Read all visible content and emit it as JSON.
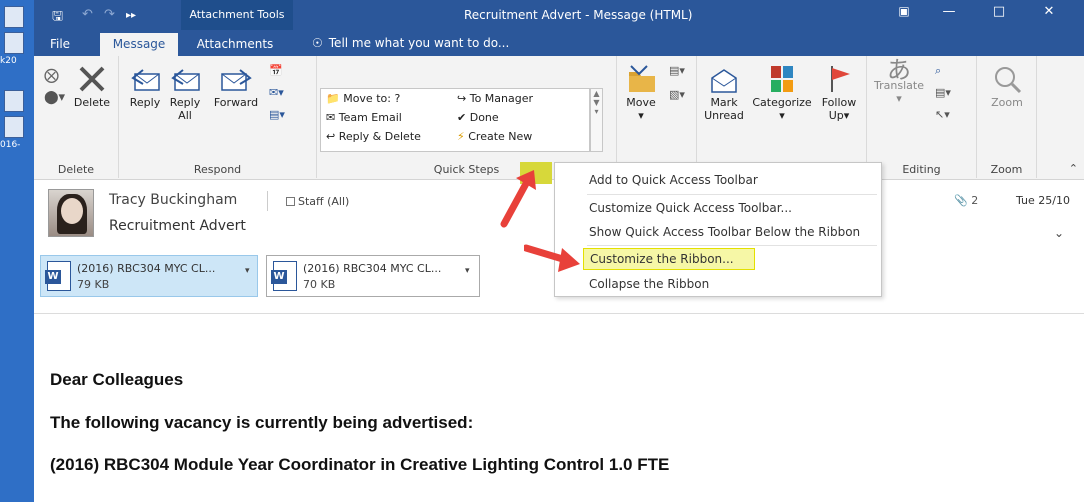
{
  "desktop": {
    "labels": [
      "k20",
      "016-"
    ]
  },
  "titlebar": {
    "context_tab": "Attachment Tools",
    "title": "Recruitment Advert - Message (HTML)",
    "tabs": [
      "File",
      "Message",
      "Attachments"
    ],
    "tell_me": "Tell me what you want to do..."
  },
  "ribbon": {
    "delete_group": {
      "label": "Delete",
      "delete_btn": "Delete"
    },
    "respond_group": {
      "label": "Respond",
      "reply": "Reply",
      "reply_all_1": "Reply",
      "reply_all_2": "All",
      "forward": "Forward"
    },
    "quick_steps_group": {
      "label": "Quick Steps",
      "items": [
        "Move to: ?",
        "To Manager",
        "Team Email",
        "Done",
        "Reply & Delete",
        "Create New"
      ]
    },
    "move_group": {
      "move": "Move"
    },
    "tags_group": {
      "mark_unread_1": "Mark",
      "mark_unread_2": "Unread",
      "categorize": "Categorize",
      "follow_up_1": "Follow",
      "follow_up_2": "Up"
    },
    "editing_group": {
      "label": "Editing",
      "translate": "Translate"
    },
    "zoom_group": {
      "label": "Zoom",
      "zoom": "Zoom"
    }
  },
  "message": {
    "sender": "Tracy Buckingham",
    "recipient": "Staff (All)",
    "subject": "Recruitment Advert",
    "attachment_count": "2",
    "date": "Tue 25/10"
  },
  "attachments": [
    {
      "name": "(2016) RBC304 MYC CL...",
      "size": "79 KB"
    },
    {
      "name": "(2016) RBC304 MYC CL...",
      "size": "70 KB"
    }
  ],
  "body": {
    "greeting": "Dear Colleagues",
    "line1": "The following vacancy is currently being advertised:",
    "line2": "(2016) RBC304 Module Year Coordinator in Creative Lighting Control 1.0 FTE"
  },
  "context_menu": {
    "items": [
      "Add to Quick Access Toolbar",
      "Customize Quick Access Toolbar...",
      "Show Quick Access Toolbar Below the Ribbon",
      "Customize the Ribbon...",
      "Collapse the Ribbon"
    ]
  },
  "colors": {
    "brand": "#2b579a",
    "highlight": "#f6f7a6",
    "arrow": "#e8413a"
  }
}
